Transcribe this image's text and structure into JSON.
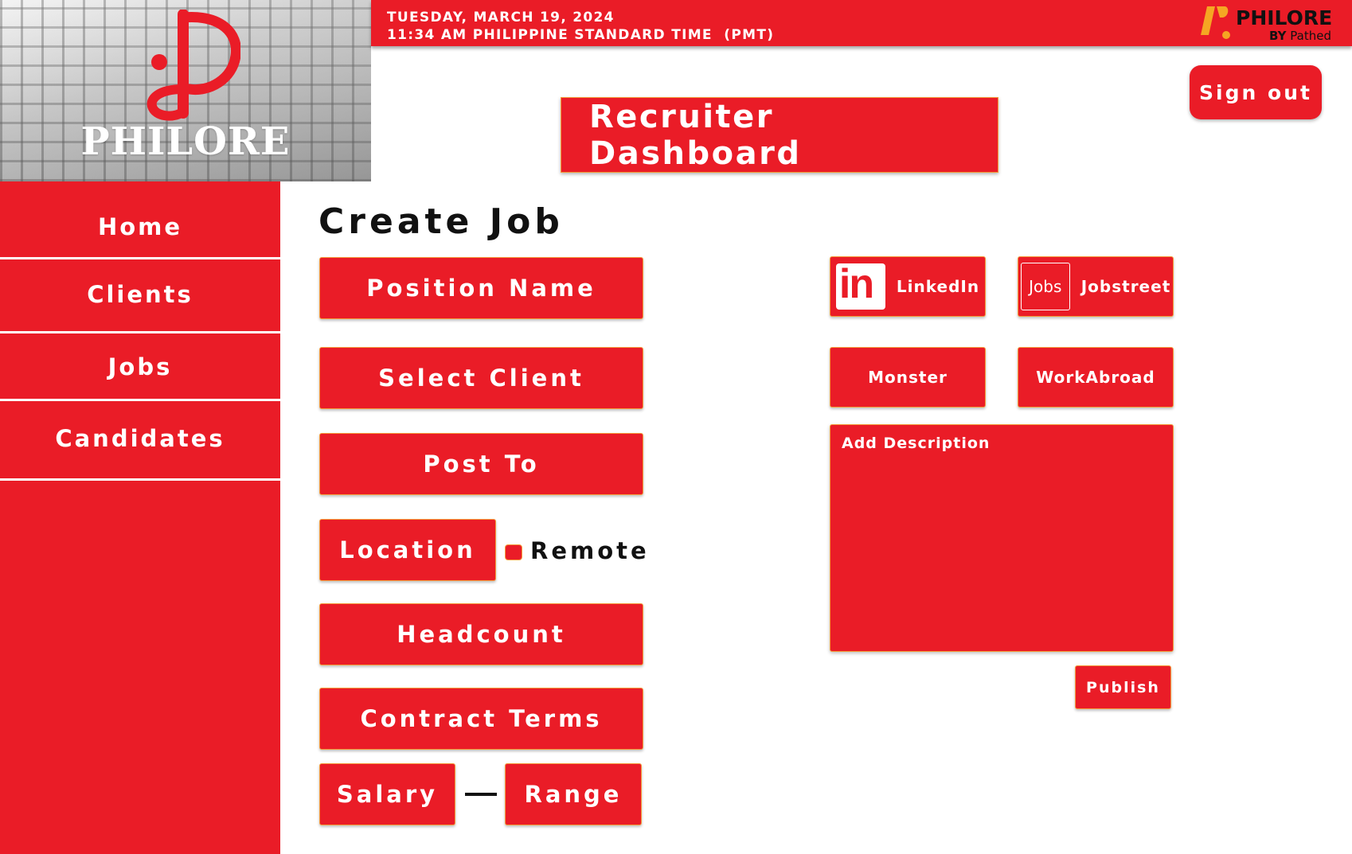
{
  "header": {
    "brand_name": "PHILORE",
    "date_line": "TUESDAY, MARCH 19, 2024",
    "time_line": "11:34 AM PHILIPPINE STANDARD TIME  (PMT)",
    "corner_brand": "PHILORE",
    "corner_by": "BY",
    "corner_partner": "Pathed"
  },
  "actions": {
    "sign_out": "Sign out"
  },
  "dashboard_title": "Recruiter Dashboard",
  "sidebar": {
    "items": [
      {
        "label": "Home"
      },
      {
        "label": "Clients"
      },
      {
        "label": "Jobs"
      },
      {
        "label": "Candidates"
      }
    ]
  },
  "form": {
    "title": "Create Job",
    "position_name": "Position Name",
    "select_client": "Select Client",
    "post_to": "Post To",
    "location": "Location",
    "remote": "Remote",
    "headcount": "Headcount",
    "contract_terms": "Contract Terms",
    "salary": "Salary",
    "range": "Range"
  },
  "platforms": {
    "linkedin": "LinkedIn",
    "linkedin_icon_text": "in",
    "jobstreet": "Jobstreet",
    "jobstreet_icon_text": "Jobs",
    "monster": "Monster",
    "workabroad": "WorkAbroad"
  },
  "description": {
    "placeholder": "Add Description"
  },
  "publish": "Publish",
  "colors": {
    "primary_red": "#ea1c27",
    "border_orange": "#f59a3a",
    "text_dark": "#111111",
    "accent_yellow": "#f5a623"
  },
  "icons": {
    "brand_mark": "philore-p-logo-icon",
    "corner_logo": "philore-corner-logo-icon",
    "linkedin": "linkedin-icon",
    "jobstreet": "jobstreet-icon"
  }
}
